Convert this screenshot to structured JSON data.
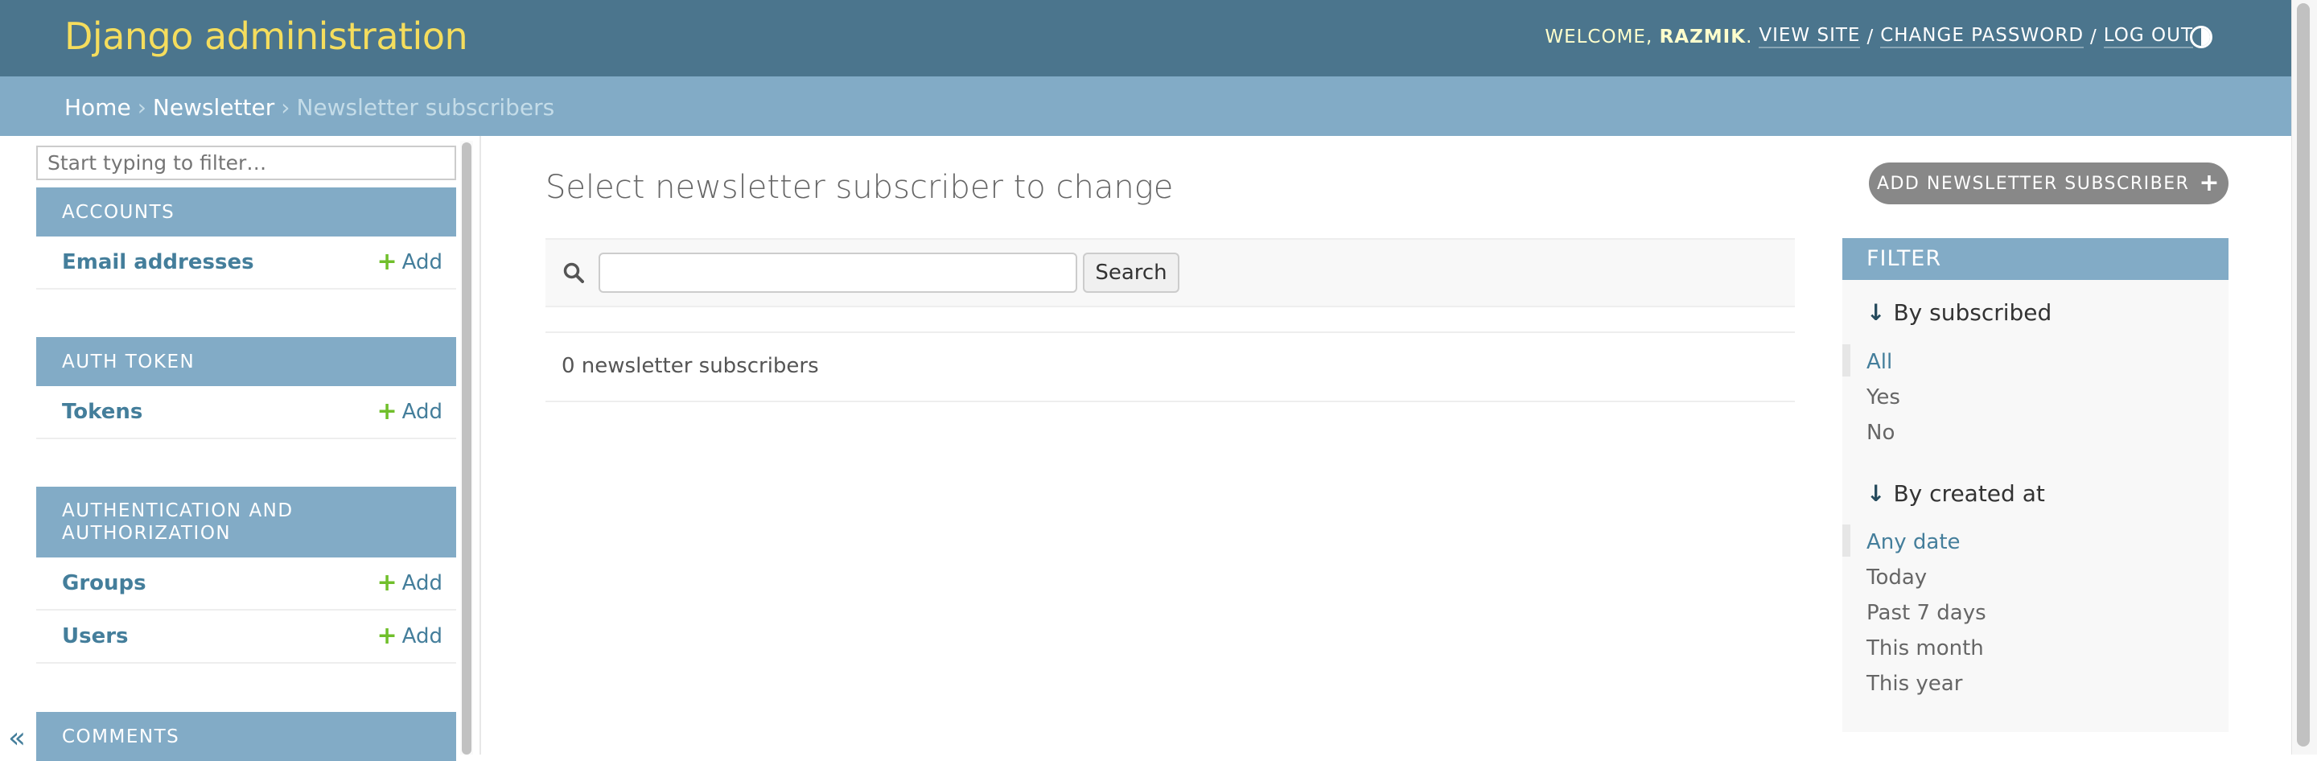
{
  "header": {
    "site_name": "Django administration",
    "welcome": "Welcome,",
    "username": "razmik",
    "view_site": "View site",
    "change_password": "Change password",
    "log_out": "Log out"
  },
  "breadcrumbs": {
    "home": "Home",
    "app": "Newsletter",
    "current": "Newsletter subscribers"
  },
  "sidebar": {
    "filter_placeholder": "Start typing to filter…",
    "add_label": "Add",
    "toggle": "«",
    "modules": [
      {
        "caption": "Accounts",
        "models": [
          "Email addresses"
        ]
      },
      {
        "caption": "Auth Token",
        "models": [
          "Tokens"
        ]
      },
      {
        "caption": "Authentication and Authorization",
        "models": [
          "Groups",
          "Users"
        ]
      },
      {
        "caption": "Comments",
        "models": []
      }
    ]
  },
  "content": {
    "title": "Select newsletter subscriber to change",
    "add_button": "Add newsletter subscriber",
    "search_button": "Search",
    "result_count": "0 newsletter subscribers"
  },
  "filter": {
    "header": "Filter",
    "groups": [
      {
        "title": "By subscribed",
        "options": [
          "All",
          "Yes",
          "No"
        ],
        "selected": 0
      },
      {
        "title": "By created at",
        "options": [
          "Any date",
          "Today",
          "Past 7 days",
          "This month",
          "This year"
        ],
        "selected": 0
      }
    ]
  },
  "colors": {
    "header_bg": "#4b758d",
    "site_name": "#f5dd5d",
    "breadcrumb_bg": "#82abc6",
    "link": "#447e9b",
    "add_plus": "#70bf2b"
  }
}
